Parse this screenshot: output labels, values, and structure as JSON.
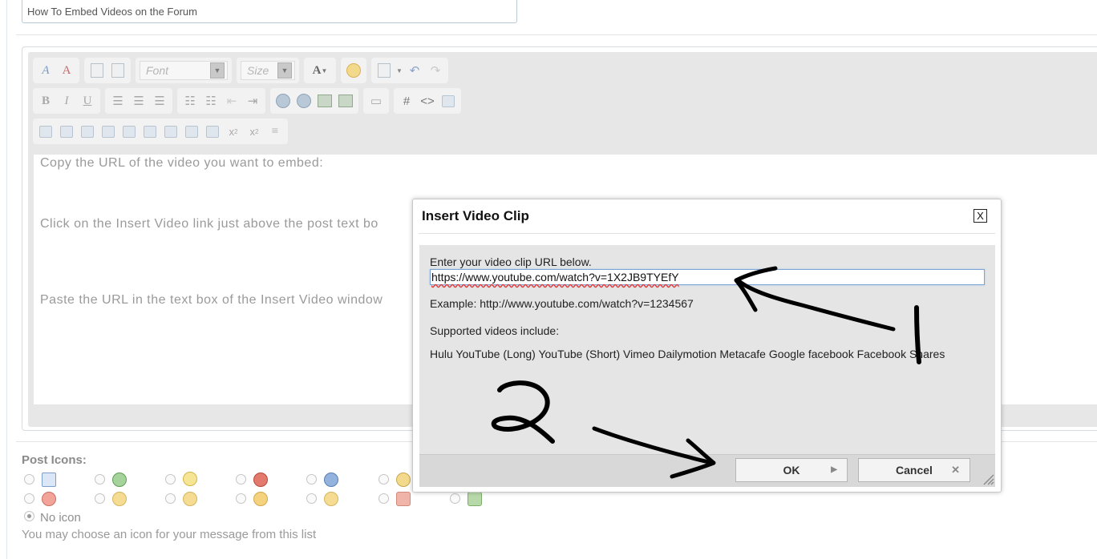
{
  "post": {
    "title_value": "How To Embed Videos on the Forum"
  },
  "toolbar": {
    "font_placeholder": "Font",
    "size_placeholder": "Size"
  },
  "editor": {
    "lines": [
      "Copy the URL of the video you want to embed:",
      "Click on the Insert Video link just above the post text bo",
      "Paste the URL in the text box of the Insert Video window"
    ]
  },
  "dialog": {
    "title": "Insert Video Clip",
    "close_label": "X",
    "prompt": "Enter your video clip URL below.",
    "url_value": "https://www.youtube.com/watch?v=1X2JB9TYEfY",
    "example": "Example: http://www.youtube.com/watch?v=1234567",
    "supported_label": "Supported videos include:",
    "supported_list": "Hulu YouTube (Long) YouTube (Short) Vimeo Dailymotion Metacafe Google facebook Facebook Shares",
    "ok_label": "OK",
    "cancel_label": "Cancel"
  },
  "post_icons": {
    "label": "Post Icons:",
    "no_icon_label": "No icon",
    "hint": "You may choose an icon for your message from this list",
    "icon_names": [
      "document-icon",
      "refresh-icon",
      "lightbulb-icon",
      "exclamation-icon",
      "question-icon",
      "cool-face-icon",
      "angry-face-icon",
      "smile-face-icon",
      "grin-face-icon",
      "happy-face-icon",
      "laugh-face-icon",
      "thumbs-down-icon",
      "thumbs-up-icon"
    ]
  },
  "annotations": {
    "label_1": "1",
    "label_2": "2"
  }
}
